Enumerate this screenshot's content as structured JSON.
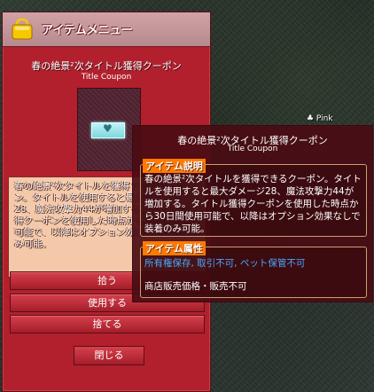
{
  "window": {
    "title": "アイテムメニュー",
    "item_name": "春の絶景²次タイトル獲得クーポン",
    "item_name_sub": "Title Coupon",
    "description": "春の絶景²次タイトルを獲得できるクーポン。タイトルを使用すると最大ダメージ28、魔法攻撃力44が増加する。タイトル獲得クーポンを使用した時点から30日間使用可能で、以降はオプション効果なしで装着のみ可能。",
    "buttons": {
      "pickup": "拾う",
      "use": "使用する",
      "drop": "捨てる",
      "close": "閉じる"
    }
  },
  "tooltip": {
    "name": "春の絶景²次タイトル獲得クーポン",
    "sub": "Title Coupon",
    "section1_title": "アイテム説明",
    "section1_text": "春の絶景²次タイトルを獲得できるクーポン。タイトルを使用すると最大ダメージ28、魔法攻撃力44が増加する。タイトル獲得クーポンを使用した時点から30日間使用可能で、以降はオプション効果なしで装着のみ可能。",
    "section2_title": "アイテム属性",
    "attr_line1": "所有権保存, 取引不可, ペット保管不可",
    "attr_line2": "商店販売価格・販売不可"
  },
  "world": {
    "nameplate": "♣ Pink"
  },
  "colors": {
    "window_red": "#b2202d",
    "tooltip_bg": "#4a0c14",
    "section_head_orange": "#ff7a00",
    "attr_blue": "#4aa8ff"
  },
  "icons": {
    "bag": "bag-icon",
    "coupon": "coupon-icon"
  }
}
